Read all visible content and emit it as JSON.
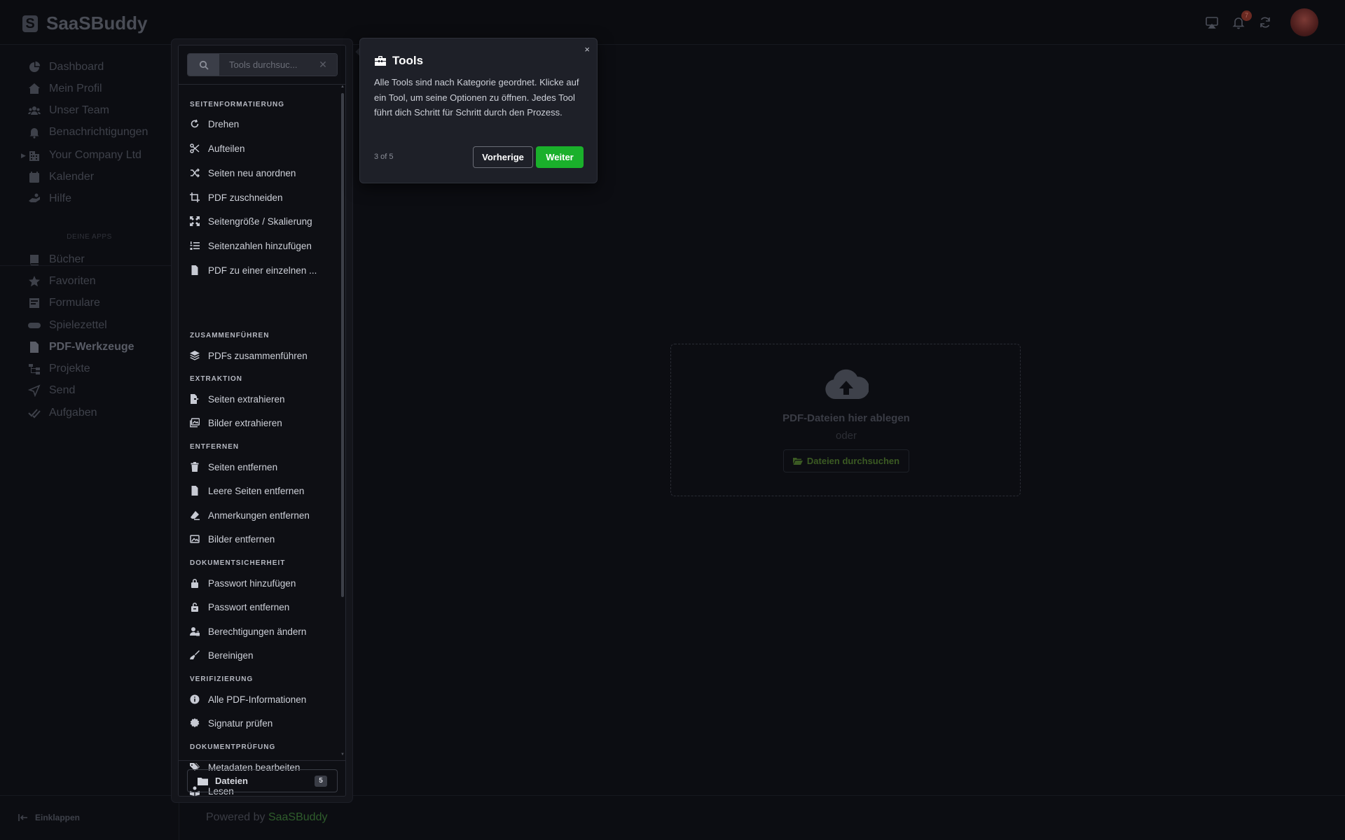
{
  "brand": {
    "name": "SaaSBuddy",
    "logo_letter": "S"
  },
  "topbar": {
    "icons": [
      "cast-icon",
      "bell-icon",
      "refresh-icon"
    ],
    "notification_count": "7"
  },
  "sidebar": {
    "items": [
      {
        "label": "Dashboard",
        "icon": "chart-pie-icon"
      },
      {
        "label": "Mein Profil",
        "icon": "home-user-icon"
      },
      {
        "label": "Unser Team",
        "icon": "users-icon"
      },
      {
        "label": "Benachrichtigungen",
        "icon": "bell-icon"
      },
      {
        "label": "Your Company Ltd",
        "icon": "building-icon"
      },
      {
        "label": "Kalender",
        "icon": "calendar-icon"
      },
      {
        "label": "Hilfe",
        "icon": "hands-help-icon"
      }
    ],
    "section_label": "DEINE APPS",
    "apps": [
      {
        "label": "Bücher",
        "icon": "book-icon"
      },
      {
        "label": "Favoriten",
        "icon": "star-icon"
      },
      {
        "label": "Formulare",
        "icon": "form-icon"
      },
      {
        "label": "Spielezettel",
        "icon": "gamepad-icon"
      },
      {
        "label": "PDF-Werkzeuge",
        "icon": "file-pdf-icon",
        "active": true
      },
      {
        "label": "Projekte",
        "icon": "sitemap-icon"
      },
      {
        "label": "Send",
        "icon": "paper-plane-icon"
      },
      {
        "label": "Aufgaben",
        "icon": "check-double-icon"
      }
    ]
  },
  "footer": {
    "collapse_label": "Einklappen",
    "powered_by": "Powered by",
    "powered_brand": "SaaSBuddy"
  },
  "tools": {
    "search_placeholder": "Tools durchsuc...",
    "categories": [
      {
        "label": "SEITENFORMATIERUNG",
        "items": [
          {
            "label": "Drehen",
            "icon": "rotate-icon"
          },
          {
            "label": "Aufteilen",
            "icon": "scissors-icon"
          },
          {
            "label": "Seiten neu anordnen",
            "icon": "shuffle-icon"
          },
          {
            "label": "PDF zuschneiden",
            "icon": "crop-icon"
          },
          {
            "label": "Seitengröße / Skalierung",
            "icon": "expand-icon"
          },
          {
            "label": "Seitenzahlen hinzufügen",
            "icon": "list-ol-icon"
          },
          {
            "label": "PDF zu einer einzelnen ...",
            "icon": "file-icon"
          }
        ]
      },
      {
        "label": "ZUSAMMENFÜHREN",
        "items": [
          {
            "label": "PDFs zusammenführen",
            "icon": "layers-icon"
          }
        ]
      },
      {
        "label": "EXTRAKTION",
        "items": [
          {
            "label": "Seiten extrahieren",
            "icon": "file-export-icon"
          },
          {
            "label": "Bilder extrahieren",
            "icon": "images-icon"
          }
        ]
      },
      {
        "label": "ENTFERNEN",
        "items": [
          {
            "label": "Seiten entfernen",
            "icon": "trash-icon"
          },
          {
            "label": "Leere Seiten entfernen",
            "icon": "file-icon"
          },
          {
            "label": "Anmerkungen entfernen",
            "icon": "eraser-icon"
          },
          {
            "label": "Bilder entfernen",
            "icon": "image-icon"
          }
        ]
      },
      {
        "label": "DOKUMENTSICHERHEIT",
        "items": [
          {
            "label": "Passwort hinzufügen",
            "icon": "lock-icon"
          },
          {
            "label": "Passwort entfernen",
            "icon": "unlock-icon"
          },
          {
            "label": "Berechtigungen ändern",
            "icon": "user-lock-icon"
          },
          {
            "label": "Bereinigen",
            "icon": "broom-icon"
          }
        ]
      },
      {
        "label": "VERIFIZIERUNG",
        "items": [
          {
            "label": "Alle PDF-Informationen",
            "icon": "info-circle-icon"
          },
          {
            "label": "Signatur prüfen",
            "icon": "certificate-icon"
          }
        ]
      },
      {
        "label": "DOKUMENTPRÜFUNG",
        "items": [
          {
            "label": "Metadaten bearbeiten",
            "icon": "tags-icon"
          },
          {
            "label": "Lesen",
            "icon": "book-reader-icon"
          }
        ]
      }
    ],
    "files_label": "Dateien",
    "files_count": "5"
  },
  "tour": {
    "title": "Tools",
    "body": "Alle Tools sind nach Kategorie geordnet. Klicke auf ein Tool, um seine Optionen zu öffnen. Jedes Tool führt dich Schritt für Schritt durch den Prozess.",
    "progress": "3 of 5",
    "prev_label": "Vorherige",
    "next_label": "Weiter",
    "close_label": "×",
    "next_color": "#1ab02b"
  },
  "dropzone": {
    "title": "PDF-Dateien hier ablegen",
    "or": "oder",
    "browse_label": "Dateien durchsuchen"
  }
}
